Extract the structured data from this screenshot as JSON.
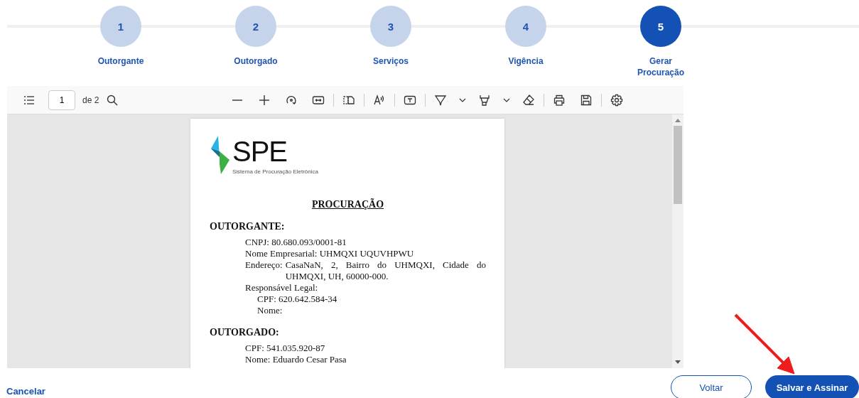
{
  "steps": [
    {
      "number": "1",
      "label": "Outorgante",
      "selected": false
    },
    {
      "number": "2",
      "label": "Outorgado",
      "selected": false
    },
    {
      "number": "3",
      "label": "Serviços",
      "selected": false
    },
    {
      "number": "4",
      "label": "Vigência",
      "selected": false
    },
    {
      "number": "5",
      "label": "Gerar Procuração",
      "selected": true
    }
  ],
  "viewer": {
    "page_input": "1",
    "page_count": "de 2",
    "document": {
      "logo_text": "SPE",
      "logo_subtitle": "Sistema de Procuração Eletrônica",
      "heading": "PROCURAÇÃO",
      "sections": [
        {
          "title": "OUTORGANTE:",
          "lines": [
            {
              "kind": "line",
              "text": "CNPJ: 80.680.093/0001-81"
            },
            {
              "kind": "line",
              "text": "Nome Empresarial: UHMQXI UQUVHPWU"
            },
            {
              "kind": "hanging",
              "label": "Endereço:",
              "text": "CasaNaN, 2, Bairro do UHMQXI, Cidade do UHMQXI, UH, 60000-000."
            },
            {
              "kind": "line",
              "text": "Responsável Legal:"
            },
            {
              "kind": "sub",
              "text": "CPF: 620.642.584-34"
            },
            {
              "kind": "sub",
              "text": "Nome:"
            }
          ]
        },
        {
          "title": "OUTORGADO:",
          "lines": [
            {
              "kind": "line",
              "text": "CPF: 541.035.920-87"
            },
            {
              "kind": "line",
              "text": "Nome: Eduardo Cesar Pasa"
            }
          ]
        }
      ]
    }
  },
  "footer": {
    "cancel": "Cancelar",
    "back": "Voltar",
    "submit": "Salvar e Assinar"
  }
}
